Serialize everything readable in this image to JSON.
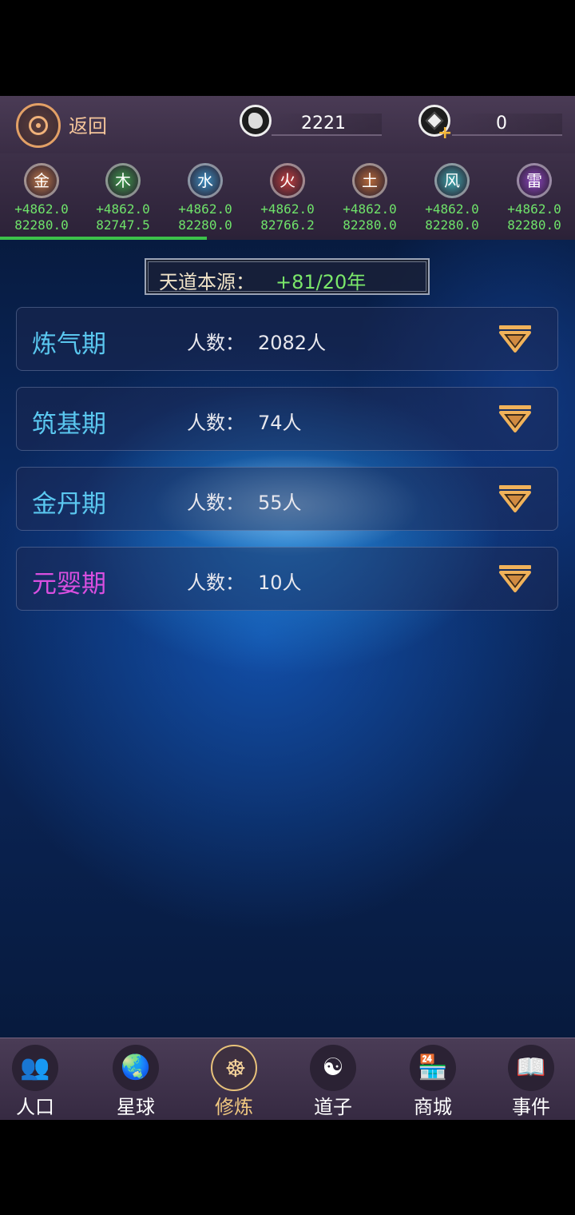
{
  "header": {
    "back_label": "返回",
    "coin_value": "2221",
    "gem_value": "0"
  },
  "elements": [
    {
      "name": "金",
      "rate": "+4862.0",
      "total": "82280.0",
      "color": "#c27a4a"
    },
    {
      "name": "木",
      "rate": "+4862.0",
      "total": "82747.5",
      "color": "#3f9b4c"
    },
    {
      "name": "水",
      "rate": "+4862.0",
      "total": "82280.0",
      "color": "#3d8fc2"
    },
    {
      "name": "火",
      "rate": "+4862.0",
      "total": "82766.2",
      "color": "#c23f3f"
    },
    {
      "name": "土",
      "rate": "+4862.0",
      "total": "82280.0",
      "color": "#b86a3a"
    },
    {
      "name": "风",
      "rate": "+4862.0",
      "total": "82280.0",
      "color": "#3faab0"
    },
    {
      "name": "雷",
      "rate": "+4862.0",
      "total": "82280.0",
      "color": "#8e45c2"
    }
  ],
  "progress": {
    "fraction": 0.36
  },
  "source": {
    "label": "天道本源：",
    "value": "+81/20年"
  },
  "stages": [
    {
      "name": "炼气期",
      "count_label": "人数：",
      "count": "2082人",
      "color": "#5ac7ef"
    },
    {
      "name": "筑基期",
      "count_label": "人数：",
      "count": "74人",
      "color": "#5ac7ef"
    },
    {
      "name": "金丹期",
      "count_label": "人数：",
      "count": "55人",
      "color": "#5ac7ef"
    },
    {
      "name": "元婴期",
      "count_label": "人数：",
      "count": "10人",
      "color": "#d94fe0"
    }
  ],
  "nav": {
    "active": "修炼",
    "items": [
      {
        "label": "人口",
        "icon": "people-icon"
      },
      {
        "label": "星球",
        "icon": "globe-icon"
      },
      {
        "label": "修炼",
        "icon": "meditation-icon"
      },
      {
        "label": "道子",
        "icon": "yin-yang-icon"
      },
      {
        "label": "商城",
        "icon": "shop-icon"
      },
      {
        "label": "事件",
        "icon": "event-book-icon"
      }
    ]
  }
}
